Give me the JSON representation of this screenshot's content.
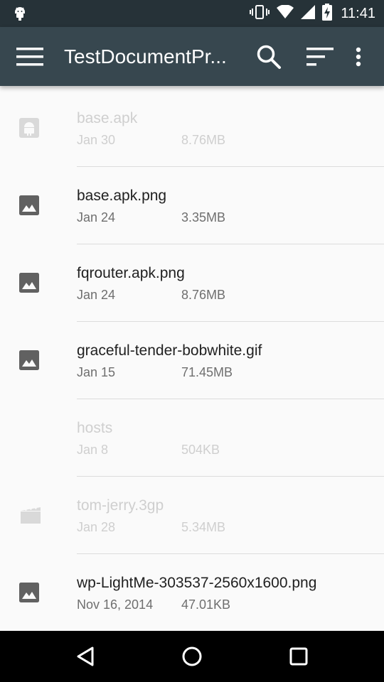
{
  "status_bar": {
    "time": "11:41",
    "left_icons": [
      "android-debug-icon"
    ],
    "right_icons": [
      "vibrate-icon",
      "wifi-icon",
      "signal-icon",
      "battery-charging-icon"
    ]
  },
  "app_bar": {
    "title": "TestDocumentPr...",
    "background": "#37474f",
    "actions": [
      "search-icon",
      "sort-icon",
      "overflow-menu-icon"
    ]
  },
  "files": [
    {
      "name": "base.apk",
      "date": "Jan 30",
      "size": "8.76MB",
      "icon": "android-icon",
      "enabled": false
    },
    {
      "name": "base.apk.png",
      "date": "Jan 24",
      "size": "3.35MB",
      "icon": "image-icon",
      "enabled": true
    },
    {
      "name": "fqrouter.apk.png",
      "date": "Jan 24",
      "size": "8.76MB",
      "icon": "image-icon",
      "enabled": true
    },
    {
      "name": "graceful-tender-bobwhite.gif",
      "date": "Jan 15",
      "size": "71.45MB",
      "icon": "image-icon",
      "enabled": true
    },
    {
      "name": "hosts",
      "date": "Jan 8",
      "size": "504KB",
      "icon": "none",
      "enabled": false
    },
    {
      "name": "tom-jerry.3gp",
      "date": "Jan 28",
      "size": "5.34MB",
      "icon": "video-icon",
      "enabled": false
    },
    {
      "name": "wp-LightMe-303537-2560x1600.png",
      "date": "Nov 16, 2014",
      "size": "47.01KB",
      "icon": "image-icon",
      "enabled": true
    }
  ],
  "nav_bar": {
    "buttons": [
      "back-icon",
      "home-icon",
      "recents-icon"
    ]
  }
}
